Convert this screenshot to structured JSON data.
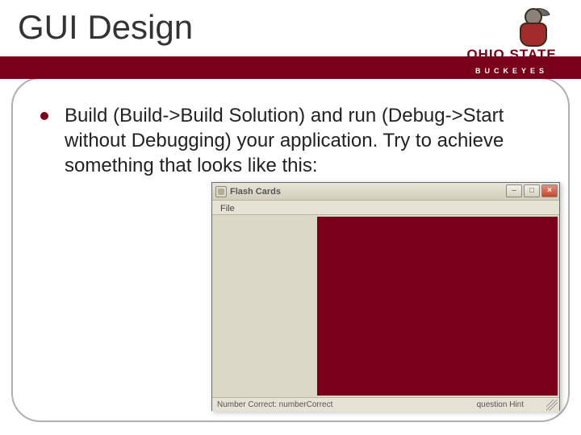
{
  "title": "GUI Design",
  "logo": {
    "line1": "OHIO STATE",
    "line2": "BUCKEYES"
  },
  "bullet_text": "Build (Build->Build Solution) and run (Debug->Start without Debugging) your application. Try to achieve something that looks like this:",
  "app_window": {
    "title": "Flash Cards",
    "menu": {
      "file": "File"
    },
    "status": {
      "left": "Number Correct: numberCorrect",
      "right": "question Hint"
    },
    "buttons": {
      "minimize": "–",
      "maximize": "□",
      "close": "×"
    }
  }
}
